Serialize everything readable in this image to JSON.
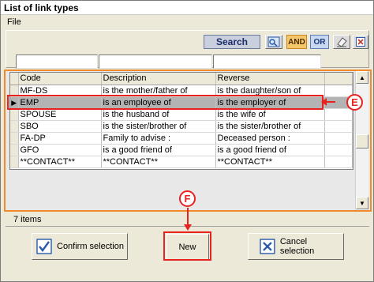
{
  "window": {
    "title": "List of link types"
  },
  "menu": {
    "file": "File"
  },
  "toolbar": {
    "search": "Search",
    "and": "AND",
    "or": "OR"
  },
  "grid": {
    "columns": [
      "Code",
      "Description",
      "Reverse"
    ],
    "rows": [
      [
        "MF-DS",
        "is the mother/father of",
        "is the daughter/son of"
      ],
      [
        "EMP",
        "is an employee of",
        "is the employer of"
      ],
      [
        "SPOUSE",
        "is the husband of",
        "is the wife of"
      ],
      [
        "SBO",
        "is the sister/brother of",
        "is the sister/brother of"
      ],
      [
        "FA-DP",
        "Family to advise :",
        "Deceased person :"
      ],
      [
        "GFO",
        "is a good friend of",
        "is a good friend of"
      ],
      [
        "**CONTACT**",
        "**CONTACT**",
        "**CONTACT**"
      ]
    ],
    "selected_row_index": 1
  },
  "status": {
    "count": "7 items"
  },
  "buttons": {
    "confirm": "Confirm selection",
    "new": "New",
    "cancel": "Cancel selection"
  },
  "callouts": {
    "e": "E",
    "f": "F"
  },
  "colors": {
    "highlight": "#e8231f",
    "frame": "#f08a2a",
    "selected_row": "#b3b3b3"
  }
}
